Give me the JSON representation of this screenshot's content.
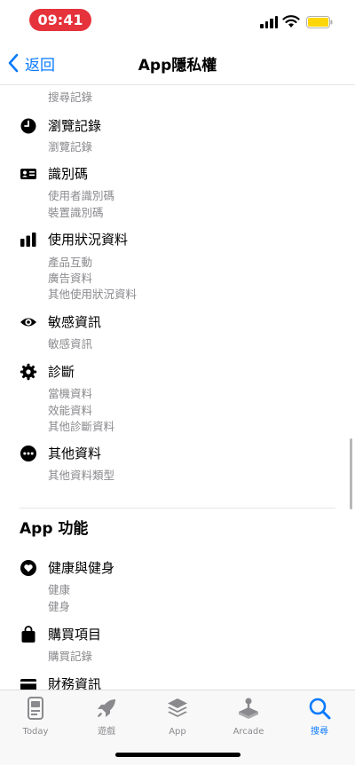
{
  "status_bar": {
    "time": "09:41"
  },
  "nav": {
    "back_label": "返回",
    "title": "App隱私權"
  },
  "top_partial_subitem": "搜尋記錄",
  "categories": [
    {
      "label": "瀏覽記錄",
      "icon": "clock-icon",
      "subitems": [
        "瀏覽記錄"
      ]
    },
    {
      "label": "識別碼",
      "icon": "id-card-icon",
      "subitems": [
        "使用者識別碼",
        "裝置識別碼"
      ]
    },
    {
      "label": "使用狀況資料",
      "icon": "bar-chart-icon",
      "subitems": [
        "產品互動",
        "廣告資料",
        "其他使用狀況資料"
      ]
    },
    {
      "label": "敏感資訊",
      "icon": "eye-icon",
      "subitems": [
        "敏感資訊"
      ]
    },
    {
      "label": "診斷",
      "icon": "gear-icon",
      "subitems": [
        "當機資料",
        "效能資料",
        "其他診斷資料"
      ]
    },
    {
      "label": "其他資料",
      "icon": "ellipsis-icon",
      "subitems": [
        "其他資料類型"
      ]
    }
  ],
  "section2": {
    "title": "App 功能",
    "categories": [
      {
        "label": "健康與健身",
        "icon": "heart-icon",
        "subitems": [
          "健康",
          "健身"
        ]
      },
      {
        "label": "購買項目",
        "icon": "shopping-bag-icon",
        "subitems": [
          "購買記錄"
        ]
      },
      {
        "label": "財務資訊",
        "icon": "credit-card-icon",
        "subitems": []
      }
    ]
  },
  "tabs": [
    {
      "label": "Today",
      "icon": "today-icon",
      "active": false
    },
    {
      "label": "遊戲",
      "icon": "rocket-icon",
      "active": false
    },
    {
      "label": "App",
      "icon": "layers-icon",
      "active": false
    },
    {
      "label": "Arcade",
      "icon": "joystick-icon",
      "active": false
    },
    {
      "label": "搜尋",
      "icon": "search-icon",
      "active": true
    }
  ],
  "colors": {
    "accent": "#0a7aff",
    "secondary_text": "#8a8a8e",
    "time_pill": "#e5323b",
    "battery": "#ffd60a"
  }
}
